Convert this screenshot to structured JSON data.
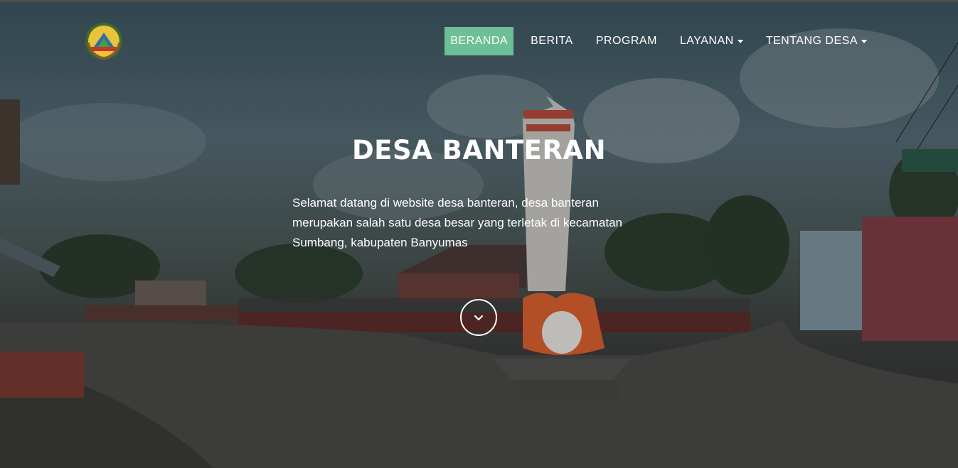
{
  "site": {
    "logo_icon": "village-emblem-icon"
  },
  "nav": {
    "items": [
      {
        "label": "BERANDA",
        "active": true,
        "dropdown": false
      },
      {
        "label": "BERITA",
        "active": false,
        "dropdown": false
      },
      {
        "label": "PROGRAM",
        "active": false,
        "dropdown": false
      },
      {
        "label": "LAYANAN",
        "active": false,
        "dropdown": true
      },
      {
        "label": "TENTANG DESA",
        "active": false,
        "dropdown": true
      }
    ],
    "active_color": "#6dbf98"
  },
  "hero": {
    "title": "DESA BANTERAN",
    "description": "Selamat datang di website desa banteran, desa banteran merupakan salah satu desa besar yang terletak di kecamatan Sumbang, kabupaten Banyumas",
    "scroll_icon": "chevron-down-icon"
  }
}
